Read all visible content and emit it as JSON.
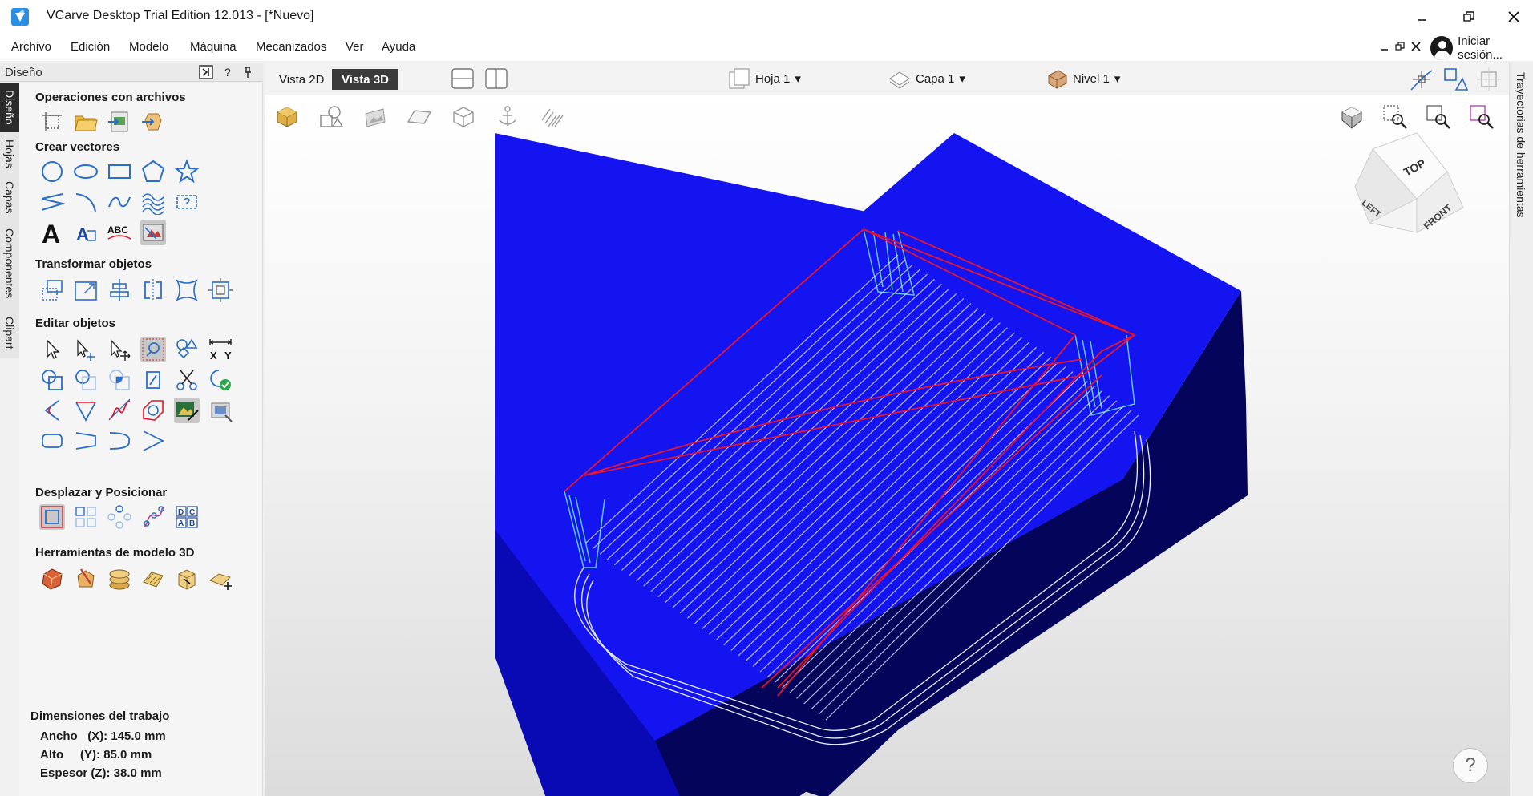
{
  "window": {
    "title": "VCarve Desktop Trial Edition 12.013 - [*Nuevo]",
    "minimize_icon": "minimize-icon",
    "restore_icon": "restore-icon",
    "close_icon": "close-icon"
  },
  "menu": {
    "items": [
      "Archivo",
      "Edición",
      "Modelo",
      "Máquina",
      "Mecanizados",
      "Ver",
      "Ayuda"
    ],
    "login_label": "Iniciar sesión..."
  },
  "side_tabs": [
    "Diseño",
    "Hojas",
    "Capas",
    "Componentes",
    "Clipart"
  ],
  "panel": {
    "title": "Diseño",
    "sections": {
      "file_ops": "Operaciones con archivos",
      "create_vectors": "Crear vectores",
      "transform": "Transformar objetos",
      "edit": "Editar objetos",
      "move": "Desplazar y Posicionar",
      "model3d": "Herramientas de modelo 3D"
    },
    "text_tools": {
      "big_a": "A",
      "small_a": "A",
      "abc": "ABC"
    },
    "dimension_tool": {
      "x": "X",
      "y": "Y"
    },
    "align_letters": [
      "D",
      "C",
      "A",
      "B"
    ]
  },
  "dimensions": {
    "title": "Dimensiones del trabajo",
    "width_label": "Ancho",
    "width_axis": "(X):",
    "width_value": "145.0 mm",
    "height_label": "Alto",
    "height_axis": "(Y):",
    "height_value": "85.0 mm",
    "thickness_label": "Espesor",
    "thickness_axis": "(Z):",
    "thickness_value": "38.0 mm"
  },
  "view_tabs": {
    "tab_2d": "Vista 2D",
    "tab_3d": "Vista 3D"
  },
  "dropdowns": {
    "sheet": "Hoja 1",
    "layer": "Capa 1",
    "level": "Nivel 1"
  },
  "right_tab": "Trayectorias de herramientas",
  "view_cube": {
    "top": "TOP",
    "left": "LEFT",
    "front": "FRONT"
  },
  "help": "?",
  "colors": {
    "material_top": "#1414f0",
    "material_left": "#0a0ab4",
    "material_right": "#04045a",
    "toolpath_red": "#e8142a",
    "toolpath_white": "#dfe6ff",
    "toolpath_cyan": "#64d2e6"
  }
}
